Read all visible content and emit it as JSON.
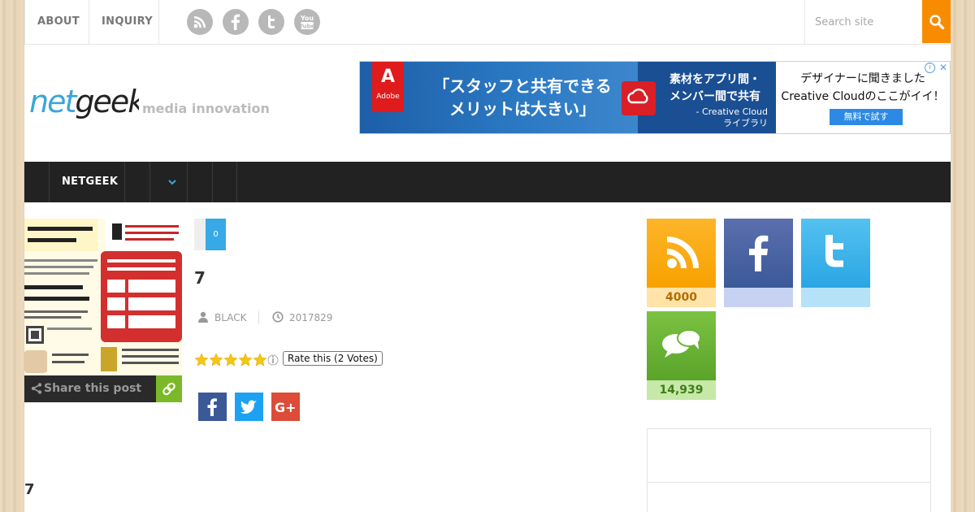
{
  "topbar": {
    "links": [
      "ABOUT",
      "INQUIRY"
    ],
    "social_icons": [
      "rss-icon",
      "facebook-icon",
      "twitter-icon",
      "youtube-icon"
    ],
    "search_placeholder": "Search site"
  },
  "header": {
    "logo_text": "netgeek",
    "tagline": "media innovation"
  },
  "ad": {
    "brand": "Adobe",
    "headline_line1": "「スタッフと共有できる",
    "headline_line2": "メリットは大きい」",
    "mid_line1": "素材をアプリ間・",
    "mid_line2": "メンバー間で共有",
    "mid_small1": "- Creative Cloud",
    "mid_small2": "ライブラリ",
    "right_line1": "デザイナーに聞きました",
    "right_line2": "Creative Cloudのここがイイ！",
    "cta": "無料で試す"
  },
  "nav": {
    "items": [
      "NETGEEK"
    ]
  },
  "thumb": {
    "share_label": "Share this post"
  },
  "post": {
    "comment_count": "0",
    "title": "7",
    "author": "BLACK",
    "date": "2017829",
    "rating_label": "Rate this (2 Votes)",
    "rating_value": 5,
    "rating_max": 5,
    "share_buttons": [
      "facebook",
      "twitter",
      "google-plus"
    ],
    "bottom_title": "7"
  },
  "sidebar": {
    "rss_count": "4000",
    "feedly_count": "14,939"
  },
  "colors": {
    "accent_orange": "#f88c00",
    "nav_bg": "#222222",
    "comment_blue": "#37a9e6",
    "share_green": "#7cb92a"
  }
}
